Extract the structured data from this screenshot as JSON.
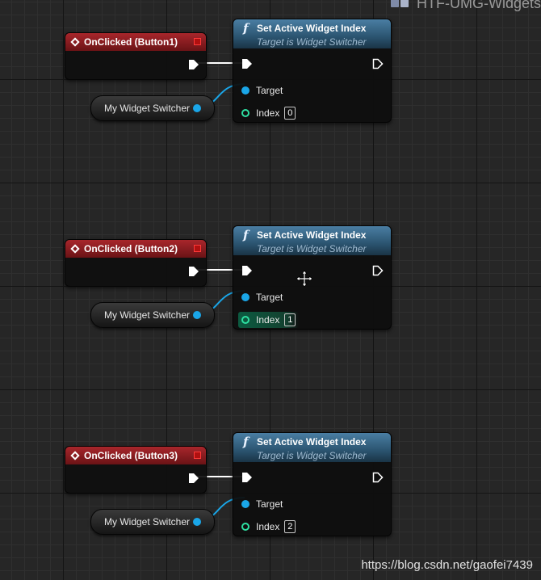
{
  "graph_title": "HTF-UMG-Widgets",
  "nodes": [
    {
      "event_title": "OnClicked (Button1)",
      "variable_label": "My Widget Switcher",
      "function_title": "Set Active Widget Index",
      "function_subtitle": "Target is Widget Switcher",
      "target_label": "Target",
      "index_label": "Index",
      "index_value": "0"
    },
    {
      "event_title": "OnClicked (Button2)",
      "variable_label": "My Widget Switcher",
      "function_title": "Set Active Widget Index",
      "function_subtitle": "Target is Widget Switcher",
      "target_label": "Target",
      "index_label": "Index",
      "index_value": "1"
    },
    {
      "event_title": "OnClicked (Button3)",
      "variable_label": "My Widget Switcher",
      "function_title": "Set Active Widget Index",
      "function_subtitle": "Target is Widget Switcher",
      "target_label": "Target",
      "index_label": "Index",
      "index_value": "2"
    }
  ],
  "watermark": "https://blog.csdn.net/gaofei7439",
  "icons": {
    "function": "f",
    "event": "diamond-icon",
    "cursor": "move-cursor-icon"
  },
  "colors": {
    "event_header": "#a8262b",
    "function_header": "#3c6a8c",
    "object_pin": "#1aa6e8",
    "integer_pin": "#2ee0a2"
  }
}
